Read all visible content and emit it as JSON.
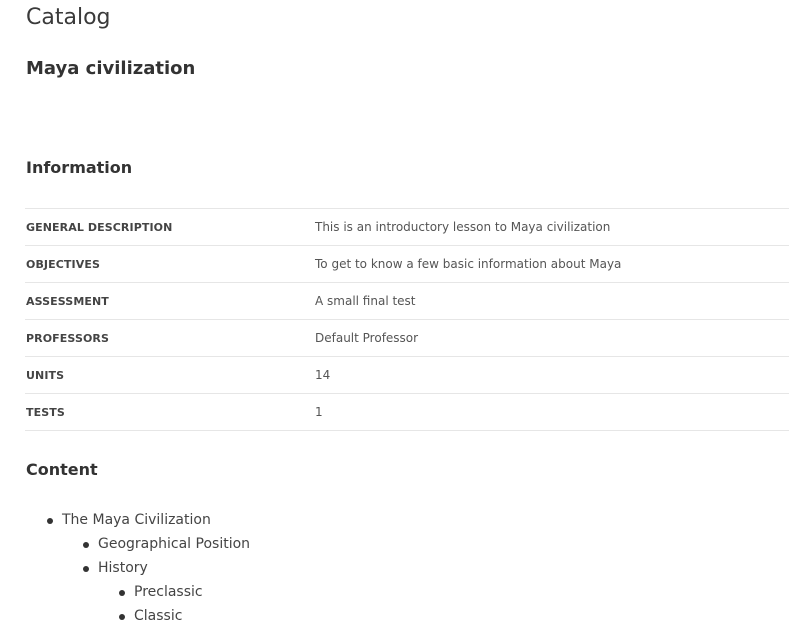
{
  "page": {
    "title": "Catalog",
    "course_title": "Maya civilization"
  },
  "information": {
    "heading": "Information",
    "rows": [
      {
        "label": "GENERAL DESCRIPTION",
        "value": "This is an introductory lesson to Maya civilization"
      },
      {
        "label": "OBJECTIVES",
        "value": "To get to know a few basic information about Maya"
      },
      {
        "label": "ASSESSMENT",
        "value": "A small final test"
      },
      {
        "label": "PROFESSORS",
        "value": "Default Professor"
      },
      {
        "label": "UNITS",
        "value": "14"
      },
      {
        "label": "TESTS",
        "value": "1"
      }
    ]
  },
  "content": {
    "heading": "Content",
    "items": [
      {
        "label": "The Maya Civilization"
      },
      {
        "label": "Geographical Position"
      },
      {
        "label": "History"
      },
      {
        "label": "Preclassic"
      },
      {
        "label": "Classic"
      }
    ]
  }
}
